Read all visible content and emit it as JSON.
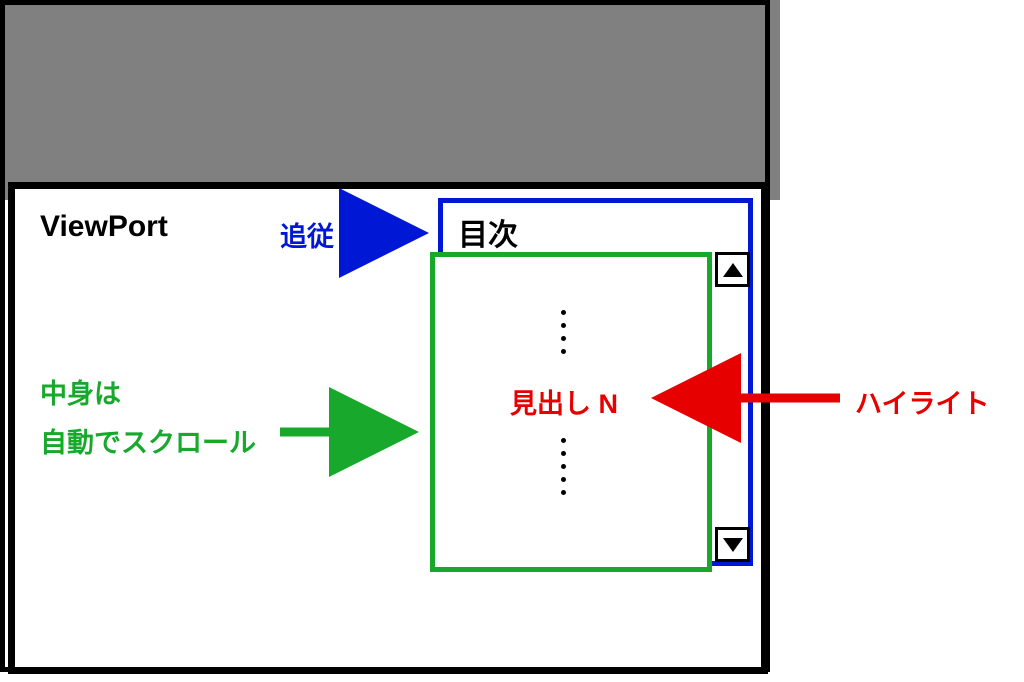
{
  "viewport": {
    "label": "ViewPort"
  },
  "follow": {
    "label": "追従"
  },
  "autoscroll": {
    "line1": "中身は",
    "line2": "自動でスクロール"
  },
  "toc": {
    "title": "目次",
    "heading": "見出し N"
  },
  "highlight": {
    "label": "ハイライト"
  },
  "colors": {
    "blue": "#0018d6",
    "green": "#18a82c",
    "red": "#e60000",
    "black": "#000000",
    "gray": "#808080"
  }
}
